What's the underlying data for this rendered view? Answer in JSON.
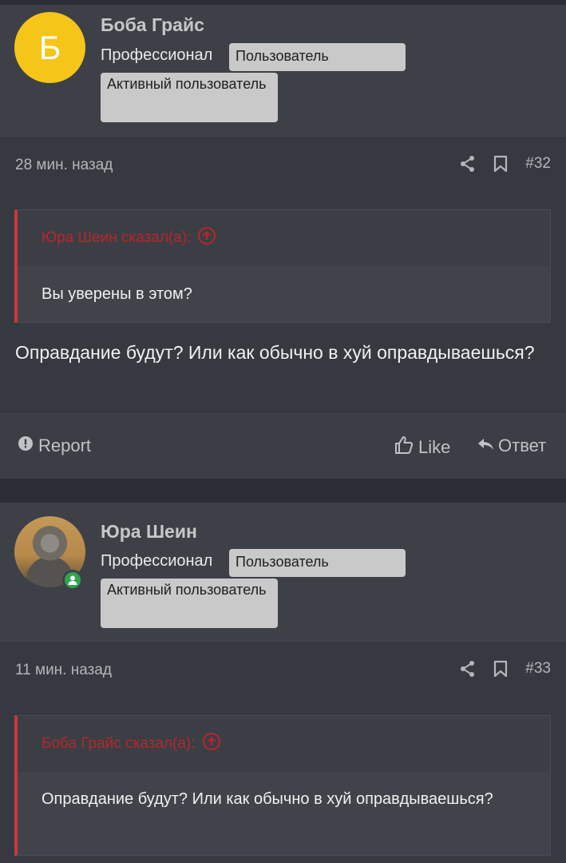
{
  "colors": {
    "accent_red": "#c8383c",
    "badge_bg": "#c9c9c9",
    "online": "#2ea44f",
    "avatar_yellow": "#f5c518"
  },
  "posts": [
    {
      "avatar_letter": "Б",
      "username": "Боба Грайс",
      "rank": "Профессионал",
      "badges": [
        "Пользователь",
        "Активный пользователь"
      ],
      "time": "28 мин. назад",
      "number": "#32",
      "quote": {
        "author": "Юра Шеин сказал(а):",
        "text": "Вы уверены в этом?"
      },
      "text": "Оправдание будут? Или как обычно в хуй оправдываешься?",
      "actions": {
        "report": "Report",
        "like": "Like",
        "reply": "Ответ"
      }
    },
    {
      "username": "Юра Шеин",
      "rank": "Профессионал",
      "badges": [
        "Пользователь",
        "Активный пользователь"
      ],
      "time": "11 мин. назад",
      "number": "#33",
      "quote": {
        "author": "Боба Грайс сказал(а):",
        "text": "Оправдание будут? Или как обычно в хуй оправдываешься?"
      }
    }
  ],
  "icons": {
    "share": "share-icon",
    "bookmark": "bookmark-icon",
    "quote_jump": "arrow-up-circle-icon",
    "report": "exclamation-circle-icon",
    "like": "thumbs-up-icon",
    "reply": "reply-icon",
    "online": "user-online-icon"
  }
}
